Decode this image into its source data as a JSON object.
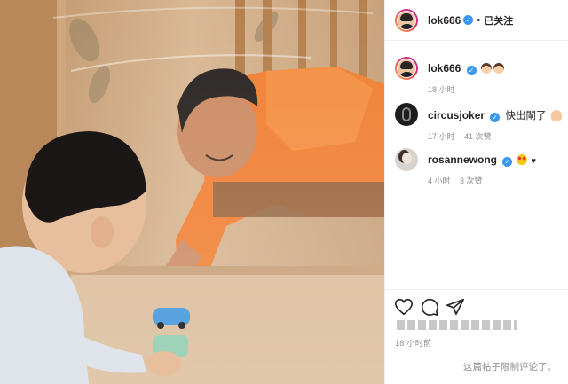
{
  "post": {
    "author": "lok666",
    "follow_status": "已关注",
    "separator": "•",
    "photo_description_icon": "photo"
  },
  "comments": [
    {
      "user": "lok666",
      "text": "",
      "emojis": [
        "boy-face-emoji",
        "boy-face-emoji"
      ],
      "time": "18 小时",
      "likes": ""
    },
    {
      "user": "circusjoker",
      "text": "快出閘了",
      "emojis": [
        "hand-emoji"
      ],
      "time": "17 小时",
      "likes": "41 次赞"
    },
    {
      "user": "rosannewong",
      "text": "",
      "emojis": [
        "star-eyes-emoji"
      ],
      "trailing": "♥",
      "time": "4 小时",
      "likes": "3 次赞"
    }
  ],
  "footer": {
    "post_time": "18 小时前",
    "comments_limited": "这篇帖子限制评论了。"
  },
  "colors": {
    "verified_blue": "#3897f0",
    "meta_gray": "#8e8e8e",
    "text": "#262626",
    "divider": "#efefef"
  }
}
